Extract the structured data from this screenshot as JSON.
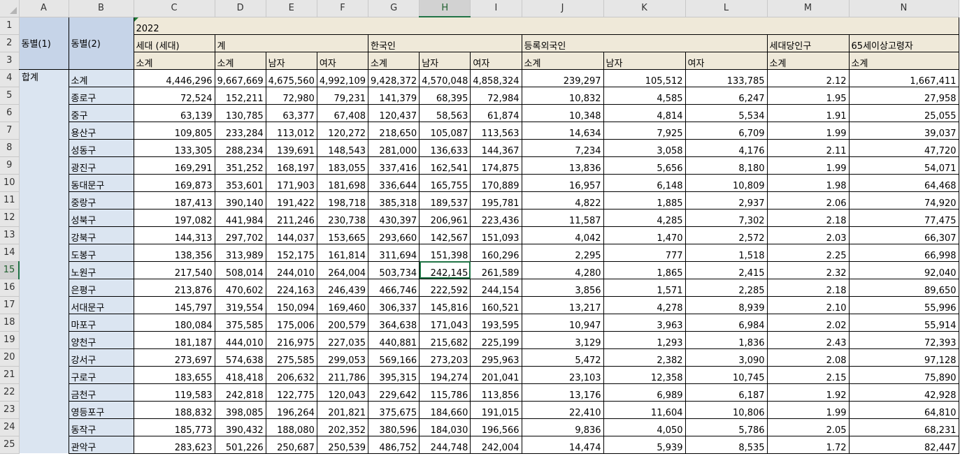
{
  "column_letters": [
    "A",
    "B",
    "C",
    "D",
    "E",
    "F",
    "G",
    "H",
    "I",
    "J",
    "K",
    "L",
    "M",
    "N"
  ],
  "row_numbers": [
    "1",
    "2",
    "3",
    "4",
    "5",
    "6",
    "7",
    "8",
    "9",
    "10",
    "11",
    "12",
    "13",
    "14",
    "15",
    "16",
    "17",
    "18",
    "19",
    "20",
    "21",
    "22",
    "23",
    "24",
    "25"
  ],
  "selected_column": "H",
  "selected_row": "15",
  "header": {
    "dong1": "동별(1)",
    "dong2": "동별(2)",
    "year": "2022",
    "households": "세대 (세대)",
    "total": "계",
    "korean": "한국인",
    "foreigner": "등록외국인",
    "per_household": "세대당인구",
    "elderly": "65세이상고령자",
    "row3": [
      "소계",
      "소계",
      "남자",
      "여자",
      "소계",
      "남자",
      "여자",
      "소계",
      "남자",
      "여자",
      "소계",
      "소계"
    ]
  },
  "group_label": "합계",
  "rows": [
    {
      "name": "소계",
      "v": [
        "4,446,296",
        "9,667,669",
        "4,675,560",
        "4,992,109",
        "9,428,372",
        "4,570,048",
        "4,858,324",
        "239,297",
        "105,512",
        "133,785",
        "2.12",
        "1,667,411"
      ]
    },
    {
      "name": "종로구",
      "v": [
        "72,524",
        "152,211",
        "72,980",
        "79,231",
        "141,379",
        "68,395",
        "72,984",
        "10,832",
        "4,585",
        "6,247",
        "1.95",
        "27,958"
      ]
    },
    {
      "name": "중구",
      "v": [
        "63,139",
        "130,785",
        "63,377",
        "67,408",
        "120,437",
        "58,563",
        "61,874",
        "10,348",
        "4,814",
        "5,534",
        "1.91",
        "25,055"
      ]
    },
    {
      "name": "용산구",
      "v": [
        "109,805",
        "233,284",
        "113,012",
        "120,272",
        "218,650",
        "105,087",
        "113,563",
        "14,634",
        "7,925",
        "6,709",
        "1.99",
        "39,037"
      ]
    },
    {
      "name": "성동구",
      "v": [
        "133,305",
        "288,234",
        "139,691",
        "148,543",
        "281,000",
        "136,633",
        "144,367",
        "7,234",
        "3,058",
        "4,176",
        "2.11",
        "47,720"
      ]
    },
    {
      "name": "광진구",
      "v": [
        "169,291",
        "351,252",
        "168,197",
        "183,055",
        "337,416",
        "162,541",
        "174,875",
        "13,836",
        "5,656",
        "8,180",
        "1.99",
        "54,071"
      ]
    },
    {
      "name": "동대문구",
      "v": [
        "169,873",
        "353,601",
        "171,903",
        "181,698",
        "336,644",
        "165,755",
        "170,889",
        "16,957",
        "6,148",
        "10,809",
        "1.98",
        "64,468"
      ]
    },
    {
      "name": "중랑구",
      "v": [
        "187,413",
        "390,140",
        "191,422",
        "198,718",
        "385,318",
        "189,537",
        "195,781",
        "4,822",
        "1,885",
        "2,937",
        "2.06",
        "74,920"
      ]
    },
    {
      "name": "성북구",
      "v": [
        "197,082",
        "441,984",
        "211,246",
        "230,738",
        "430,397",
        "206,961",
        "223,436",
        "11,587",
        "4,285",
        "7,302",
        "2.18",
        "77,475"
      ]
    },
    {
      "name": "강북구",
      "v": [
        "144,313",
        "297,702",
        "144,037",
        "153,665",
        "293,660",
        "142,567",
        "151,093",
        "4,042",
        "1,470",
        "2,572",
        "2.03",
        "66,307"
      ]
    },
    {
      "name": "도봉구",
      "v": [
        "138,356",
        "313,989",
        "152,175",
        "161,814",
        "311,694",
        "151,398",
        "160,296",
        "2,295",
        "777",
        "1,518",
        "2.25",
        "66,998"
      ]
    },
    {
      "name": "노원구",
      "v": [
        "217,540",
        "508,014",
        "244,010",
        "264,004",
        "503,734",
        "242,145",
        "261,589",
        "4,280",
        "1,865",
        "2,415",
        "2.32",
        "92,040"
      ]
    },
    {
      "name": "은평구",
      "v": [
        "213,876",
        "470,602",
        "224,163",
        "246,439",
        "466,746",
        "222,592",
        "244,154",
        "3,856",
        "1,571",
        "2,285",
        "2.18",
        "89,650"
      ]
    },
    {
      "name": "서대문구",
      "v": [
        "145,797",
        "319,554",
        "150,094",
        "169,460",
        "306,337",
        "145,816",
        "160,521",
        "13,217",
        "4,278",
        "8,939",
        "2.10",
        "55,996"
      ]
    },
    {
      "name": "마포구",
      "v": [
        "180,084",
        "375,585",
        "175,006",
        "200,579",
        "364,638",
        "171,043",
        "193,595",
        "10,947",
        "3,963",
        "6,984",
        "2.02",
        "55,914"
      ]
    },
    {
      "name": "양천구",
      "v": [
        "181,187",
        "444,010",
        "216,975",
        "227,035",
        "440,881",
        "215,682",
        "225,199",
        "3,129",
        "1,293",
        "1,836",
        "2.43",
        "72,393"
      ]
    },
    {
      "name": "강서구",
      "v": [
        "273,697",
        "574,638",
        "275,585",
        "299,053",
        "569,166",
        "273,203",
        "295,963",
        "5,472",
        "2,382",
        "3,090",
        "2.08",
        "97,128"
      ]
    },
    {
      "name": "구로구",
      "v": [
        "183,655",
        "418,418",
        "206,632",
        "211,786",
        "395,315",
        "194,274",
        "201,041",
        "23,103",
        "12,358",
        "10,745",
        "2.15",
        "75,890"
      ]
    },
    {
      "name": "금천구",
      "v": [
        "119,583",
        "242,818",
        "122,775",
        "120,043",
        "229,642",
        "115,786",
        "113,856",
        "13,176",
        "6,989",
        "6,187",
        "1.92",
        "42,928"
      ]
    },
    {
      "name": "영등포구",
      "v": [
        "188,832",
        "398,085",
        "196,264",
        "201,821",
        "375,675",
        "184,660",
        "191,015",
        "22,410",
        "11,604",
        "10,806",
        "1.99",
        "64,810"
      ]
    },
    {
      "name": "동작구",
      "v": [
        "185,773",
        "390,432",
        "188,080",
        "202,352",
        "380,596",
        "184,030",
        "196,566",
        "9,836",
        "4,050",
        "5,786",
        "2.05",
        "68,231"
      ]
    },
    {
      "name": "관악구",
      "v": [
        "283,623",
        "501,226",
        "250,687",
        "250,539",
        "486,752",
        "244,748",
        "242,004",
        "14,474",
        "5,939",
        "8,535",
        "1.72",
        "82,447"
      ]
    }
  ]
}
